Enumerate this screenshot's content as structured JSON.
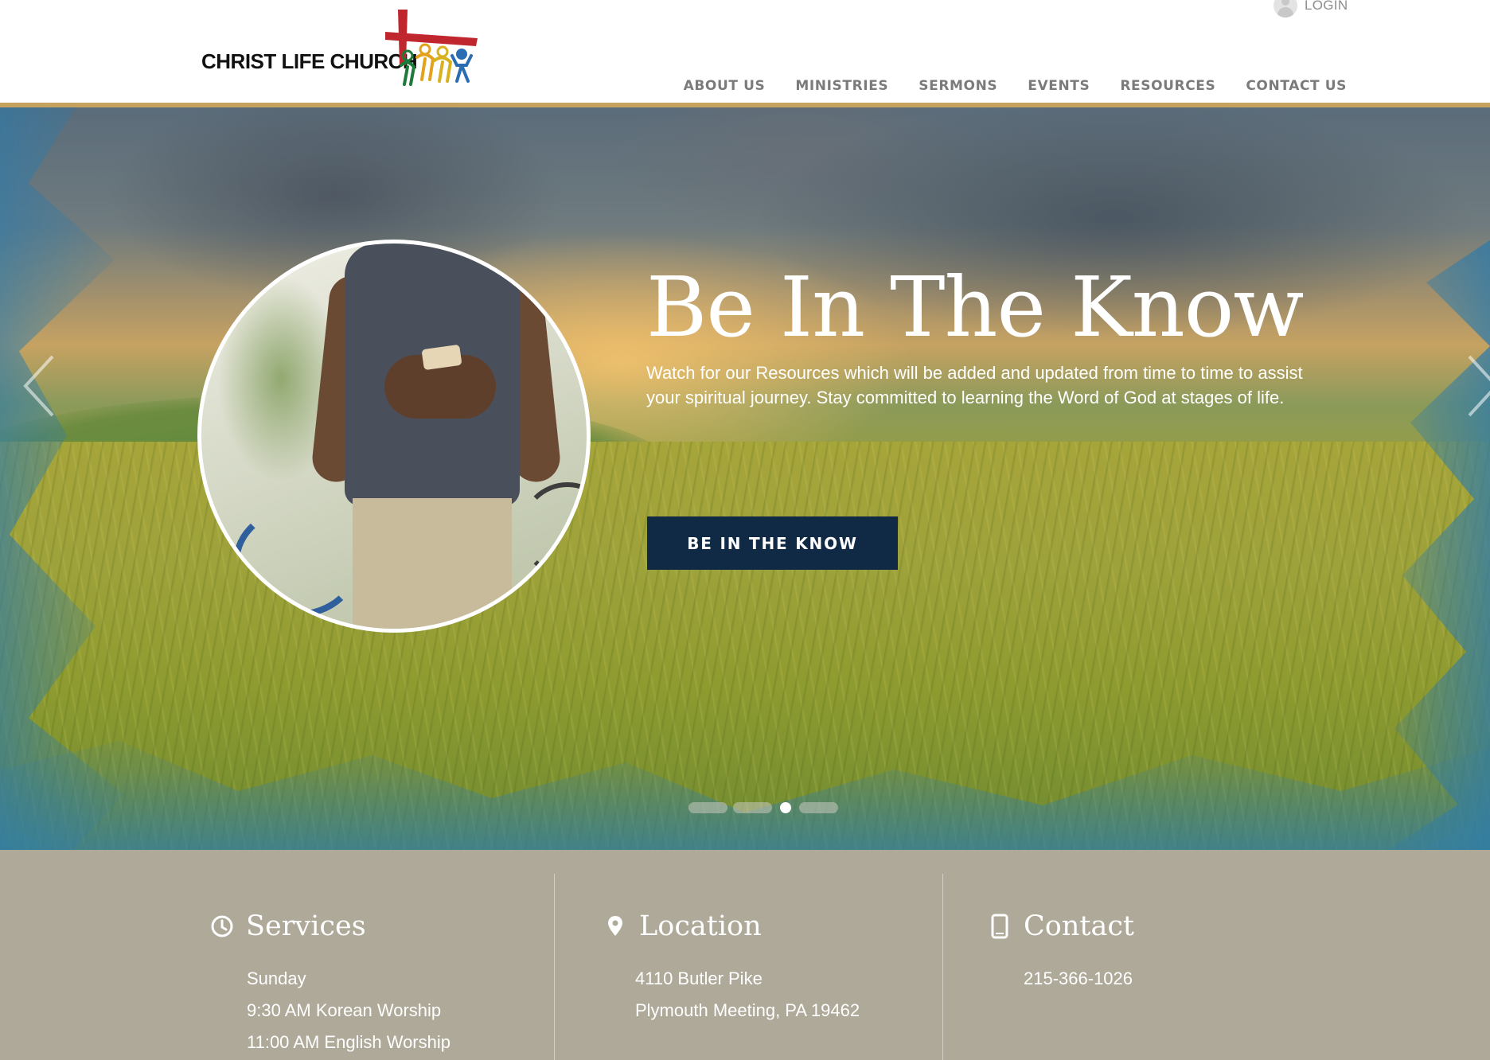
{
  "brand": {
    "name": "Christ Life Church",
    "colors": {
      "gold": "#c6a25f",
      "navy": "#102a45",
      "cross_red": "#c0262d",
      "info_bar": "#aea998"
    }
  },
  "header": {
    "login_label": "LOGIN",
    "nav": [
      {
        "label": "ABOUT US"
      },
      {
        "label": "MINISTRIES"
      },
      {
        "label": "SERMONS"
      },
      {
        "label": "EVENTS"
      },
      {
        "label": "RESOURCES"
      },
      {
        "label": "CONTACT US"
      }
    ]
  },
  "hero": {
    "title": "Be In The Know",
    "text": "Watch for our Resources which will be added and updated from time to time to assist your spiritual journey. Stay committed to learning the Word of God at stages of life.",
    "button_label": "BE IN THE KNOW",
    "slide_count": 4,
    "active_slide": 3,
    "icons": {
      "prev": "chevron-left-icon",
      "next": "chevron-right-icon"
    }
  },
  "info": {
    "services": {
      "icon": "clock-icon",
      "title": "Services",
      "lines": [
        "Sunday",
        "9:30 AM Korean Worship",
        "11:00 AM English Worship"
      ]
    },
    "location": {
      "icon": "map-pin-icon",
      "title": "Location",
      "lines": [
        "4110 Butler Pike",
        "Plymouth Meeting, PA 19462"
      ]
    },
    "contact": {
      "icon": "mobile-phone-icon",
      "title": "Contact",
      "lines": [
        "215-366-1026"
      ]
    }
  }
}
